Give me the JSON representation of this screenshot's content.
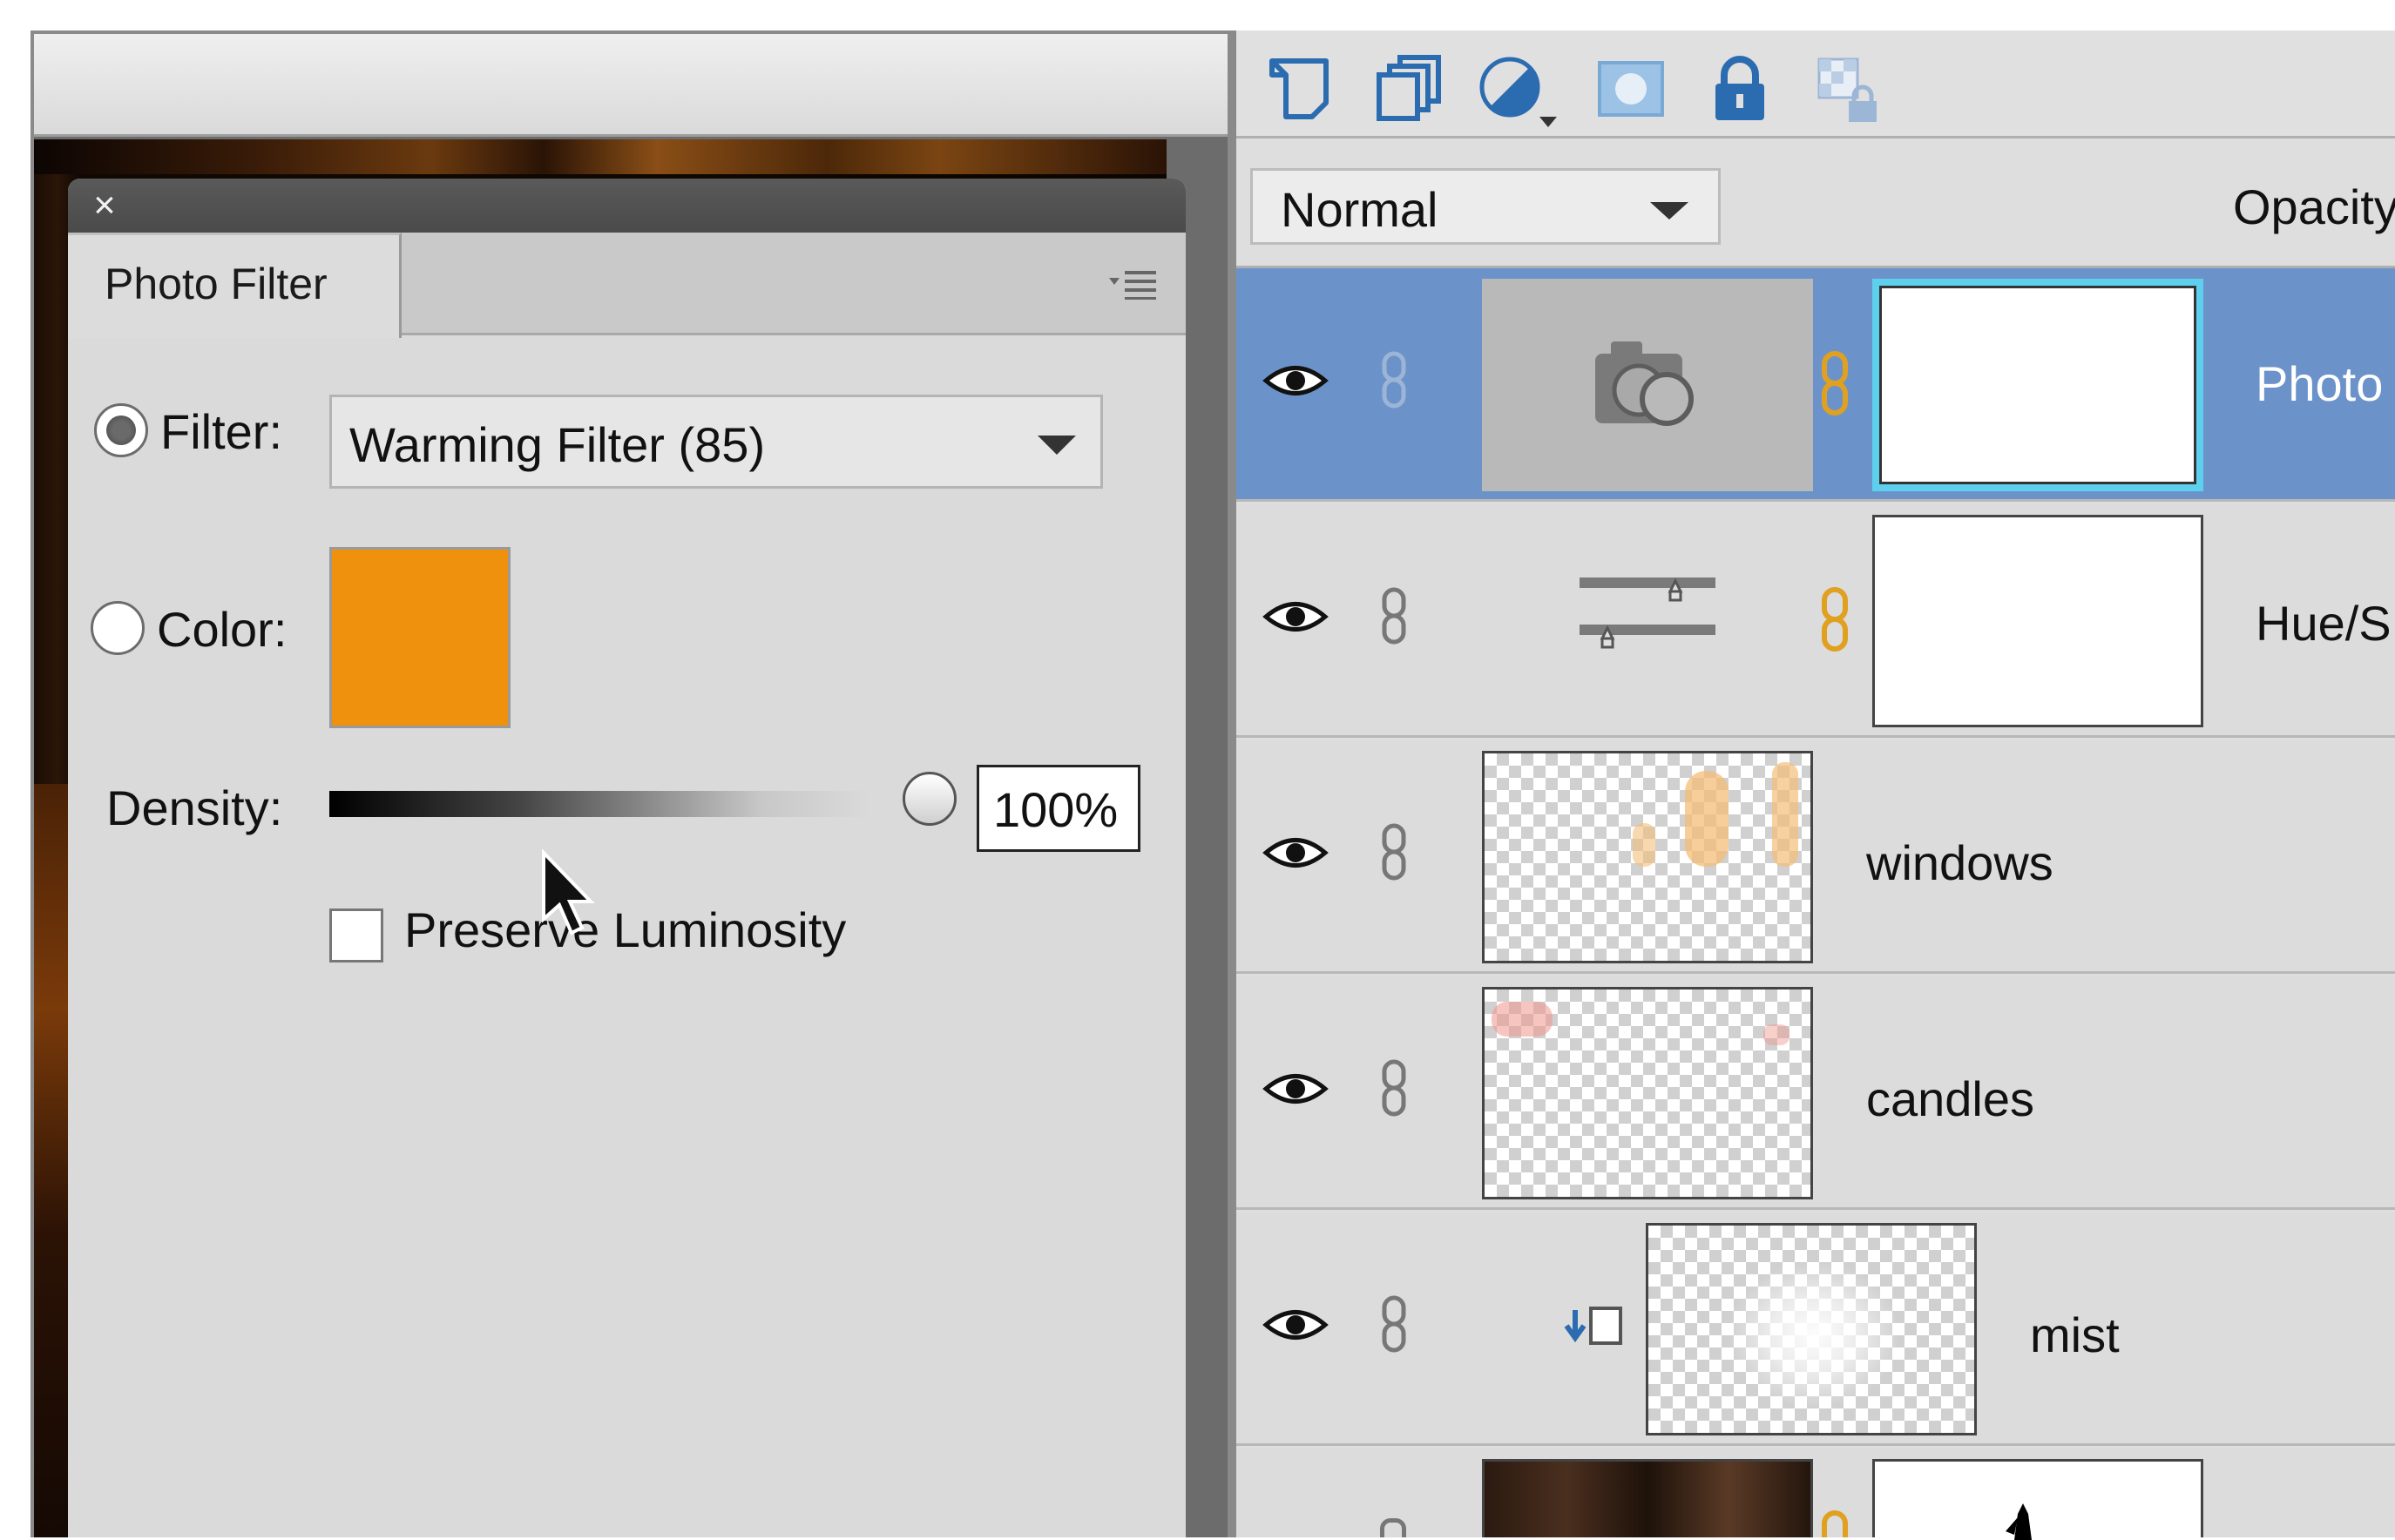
{
  "photo_filter": {
    "close_glyph": "×",
    "tab_label": "Photo Filter",
    "menu_glyph": "▾≡",
    "filter_label": "Filter:",
    "filter_value": "Warming Filter (85)",
    "filter_selected": true,
    "color_label": "Color:",
    "color_value": "#F0910D",
    "density_label": "Density:",
    "density_value": "100%",
    "density_fraction": 1.0,
    "preserve_luminosity_label": "Preserve Luminosity",
    "preserve_luminosity_checked": false
  },
  "layers": {
    "toolbar_icons": [
      "new-layer-icon",
      "new-group-icon",
      "adjustment-layer-icon",
      "layer-mask-icon",
      "lock-all-icon",
      "lock-transparency-icon"
    ],
    "blend_mode": "Normal",
    "opacity_label": "Opacity",
    "rows": [
      {
        "name": "Photo",
        "selected": true,
        "type": "photo-filter-adjustment"
      },
      {
        "name": "Hue/S",
        "selected": false,
        "type": "hue-saturation-adjustment"
      },
      {
        "name": "windows",
        "selected": false,
        "type": "pixel"
      },
      {
        "name": "candles",
        "selected": false,
        "type": "pixel"
      },
      {
        "name": "mist",
        "selected": false,
        "type": "pixel-clipped"
      },
      {
        "name": "",
        "selected": false,
        "type": "pixel-with-mask"
      }
    ]
  },
  "colors": {
    "selection_blue": "#6B93C9",
    "panel_gray": "#DADADA",
    "swatch_orange": "#F0910D",
    "link_gold": "#E0A020"
  }
}
